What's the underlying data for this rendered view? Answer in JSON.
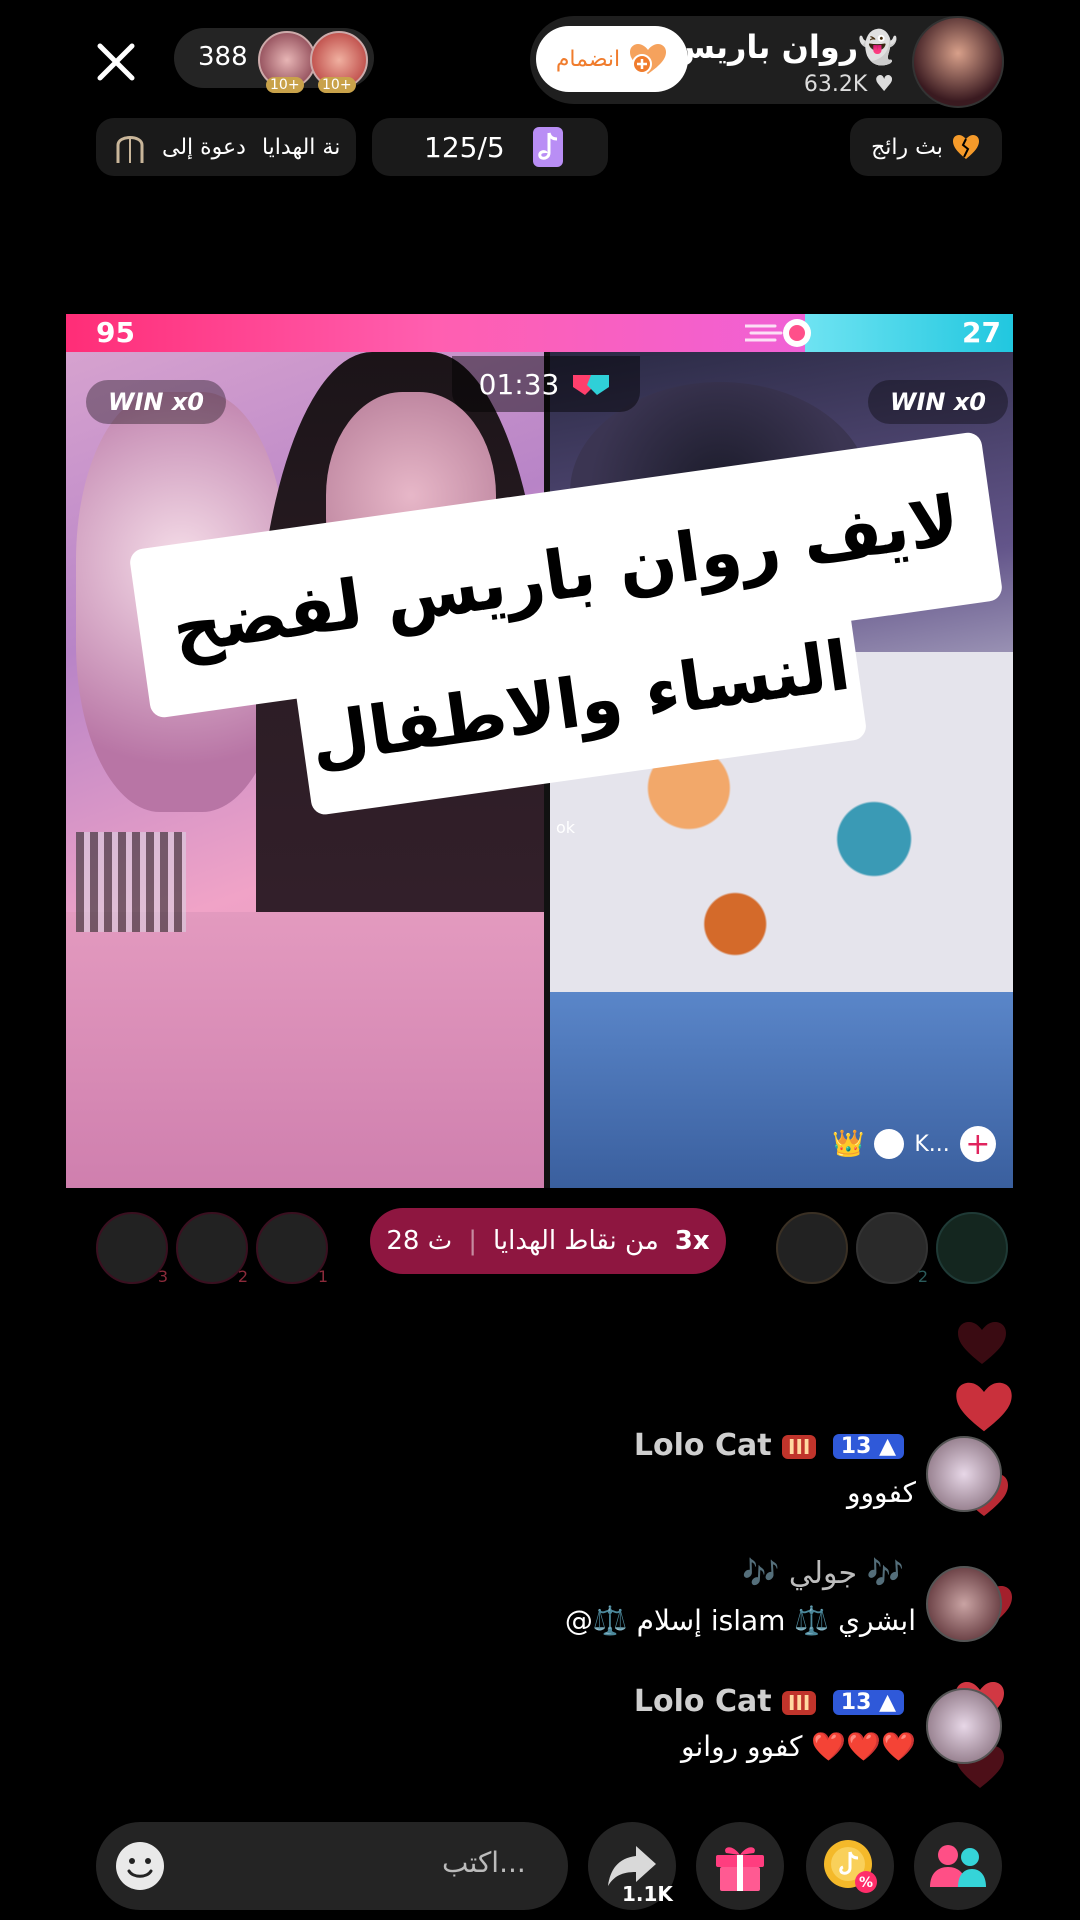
{
  "topbar": {
    "viewer_count": "388",
    "viewer_badges": [
      "10+",
      "10+"
    ],
    "host_name": "روان باريس👻",
    "host_likes": "63.2K",
    "join_label": "انضمام"
  },
  "chips": {
    "invite": "دعوة إلى",
    "gifts": "نة الهدايا",
    "progress": "125/5",
    "trending": "بث رائج"
  },
  "battle": {
    "left_score": "95",
    "right_score": "27",
    "left_share": 0.78,
    "timer": "01:33",
    "left_win": "WIN x0",
    "right_win": "WIN x0"
  },
  "caption": {
    "line1": "لايف روان باريس لفضح",
    "line2": "النساء والاطفال"
  },
  "video_right": {
    "tag": "ok",
    "controls_label": "K..."
  },
  "points": {
    "multiplier": "3x",
    "text": "من نقاط الهدايا",
    "seconds": "28 ث"
  },
  "rank_left": [
    "3",
    "2",
    "1"
  ],
  "rank_right": [
    "2"
  ],
  "comments": [
    {
      "name": "Lolo Cat",
      "level": "13",
      "text": "كفووو"
    },
    {
      "name": "🎶 جولي 🎶",
      "level": "",
      "text": "@⚖️ إسلام islam ⚖️ ابشري"
    },
    {
      "name": "Lolo Cat",
      "level": "13",
      "text": "كفوو روانو ❤️❤️❤️"
    }
  ],
  "bottom": {
    "input_placeholder": "اكتب...",
    "share_count": "1.1K"
  },
  "colors": {
    "battle_left": "#ff2d77",
    "battle_right": "#21c7df",
    "points_bg": "#8e1640",
    "join_text": "#f07c2d"
  }
}
